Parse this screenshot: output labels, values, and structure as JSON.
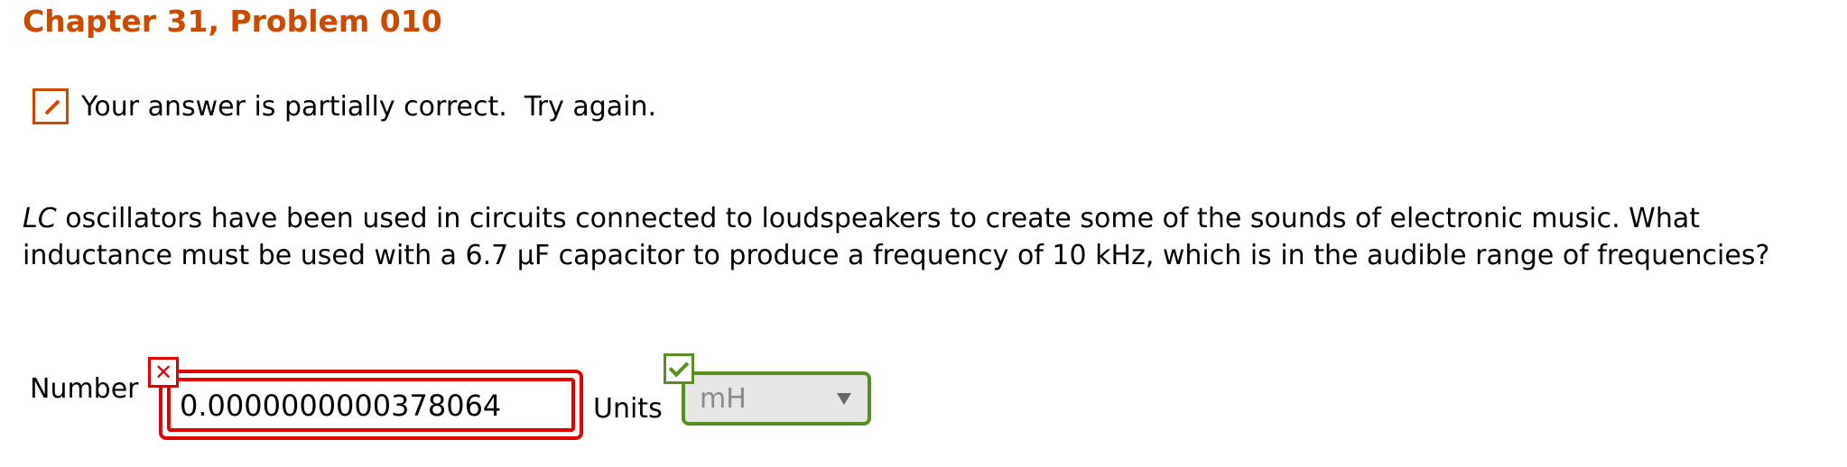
{
  "header": {
    "title": "Chapter 31, Problem 010"
  },
  "feedback": {
    "icon": "pencil-icon",
    "message": "Your answer is partially correct.  Try again."
  },
  "question": {
    "italic_prefix": "LC",
    "text": " oscillators have been used in circuits connected to loudspeakers to create some of the sounds of electronic music. What inductance must be used with a 6.7 μF capacitor to produce a frequency of 10 kHz, which is in the audible range of frequencies?"
  },
  "answer": {
    "number_label": "Number",
    "number_value": "0.0000000000378064",
    "number_status_icon": "x-icon",
    "number_status_symbol": "✕",
    "units_label": "Units",
    "units_value": "mH",
    "units_status_icon": "check-icon"
  },
  "colors": {
    "title": "#cc4a00",
    "incorrect": "#e00000",
    "correct": "#5a8f1f",
    "select_bg": "#e6e6e6"
  }
}
